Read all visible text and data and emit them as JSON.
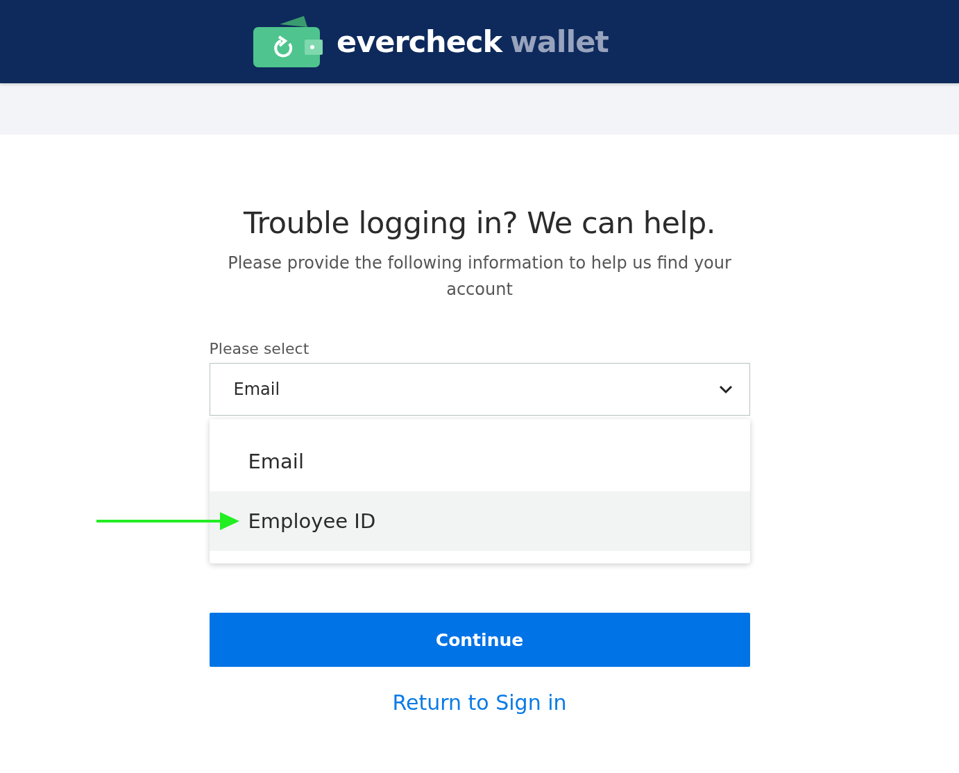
{
  "header": {
    "brand_primary": "evercheck",
    "brand_secondary": "wallet"
  },
  "heading": "Trouble logging in? We can help.",
  "subtitle": "Please provide the following information to help us find your account",
  "select": {
    "label": "Please select",
    "value": "Email",
    "expanded": true,
    "options": [
      {
        "label": "Email",
        "highlighted": false
      },
      {
        "label": "Employee ID",
        "highlighted": true,
        "annotated": true
      }
    ]
  },
  "continue_button": "Continue",
  "return_link": "Return to Sign in"
}
